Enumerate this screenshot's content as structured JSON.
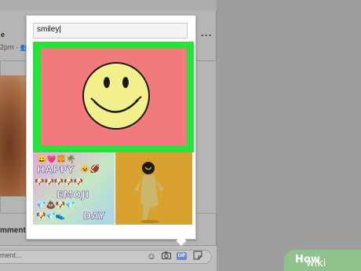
{
  "post": {
    "author_partial": "e",
    "meta_partial": "2pm · ",
    "action_partial": "mment",
    "comment_placeholder_partial": "ment..."
  },
  "gif_picker": {
    "search_value": "smiley",
    "results": [
      {
        "name": "smiley-face-gif",
        "selected": true
      },
      {
        "name": "happy-emoji-day-gif",
        "caption_words": [
          "HAPPY",
          "EMOJI",
          "DAY"
        ]
      },
      {
        "name": "dancing-smiley-costume-gif"
      }
    ]
  },
  "comment_icons": [
    "smiley-icon",
    "camera-icon",
    "gif-icon",
    "sticker-icon"
  ],
  "gif_button_label": "GIF",
  "watermark": {
    "prefix": "wiki",
    "suffix": "How"
  },
  "colors": {
    "highlight": "#22e43a",
    "gif_bg": "#f27a7c",
    "smiley_face": "#f2f08c"
  }
}
